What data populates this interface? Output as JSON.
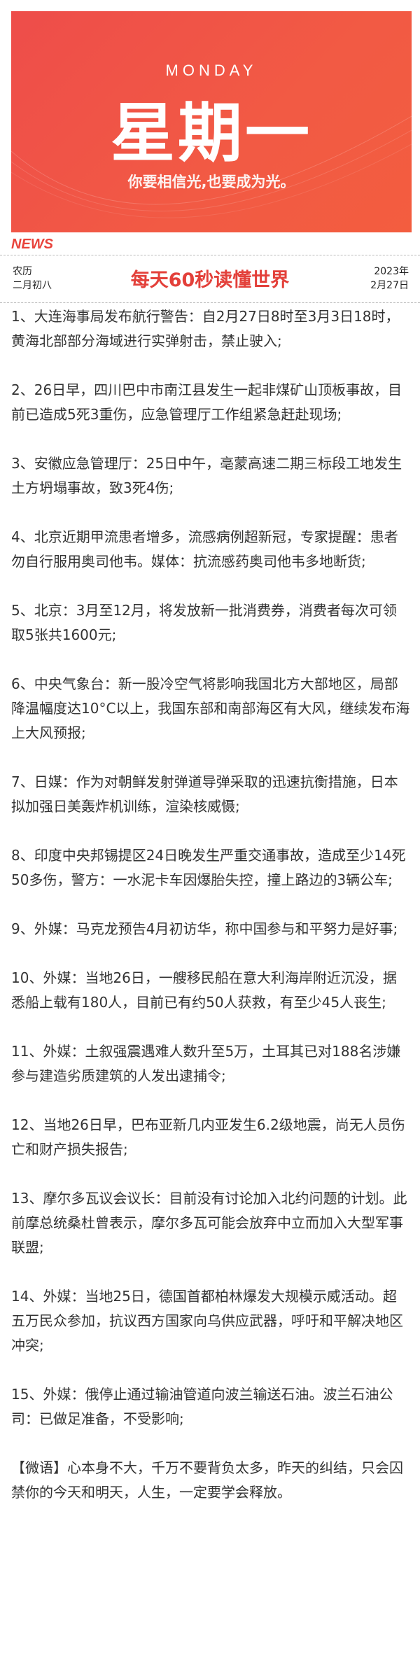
{
  "banner": {
    "weekday_en": "MONDAY",
    "weekday_cn": "星期一",
    "motto": "你要相信光,也要成为光。"
  },
  "news_label": "NEWS",
  "header": {
    "lunar_label": "农历",
    "lunar_date": "二月初八",
    "title": "每天60秒读懂世界",
    "year": "2023年",
    "date": "2月27日"
  },
  "colors": {
    "accent": "#e8433b",
    "banner": "#f05446",
    "text": "#333333"
  },
  "items": [
    "1、大连海事局发布航行警告：自2月27日8时至3月3日18时，黄海北部部分海域进行实弹射击，禁止驶入;",
    "2、26日早，四川巴中市南江县发生一起非煤矿山顶板事故，目前已造成5死3重伤，应急管理厅工作组紧急赶赴现场;",
    "3、安徽应急管理厅：25日中午，亳蒙高速二期三标段工地发生土方坍塌事故，致3死4伤;",
    "4、北京近期甲流患者增多，流感病例超新冠，专家提醒：患者勿自行服用奥司他韦。媒体：抗流感药奥司他韦多地断货;",
    "5、北京：3月至12月，将发放新一批消费券，消费者每次可领取5张共1600元;",
    "6、中央气象台：新一股冷空气将影响我国北方大部地区，局部降温幅度达10°C以上，我国东部和南部海区有大风，继续发布海上大风预报;",
    "7、日媒：作为对朝鲜发射弹道导弹采取的迅速抗衡措施，日本拟加强日美轰炸机训练，渲染核威慑;",
    "8、印度中央邦锡提区24日晚发生严重交通事故，造成至少14死50多伤，警方：一水泥卡车因爆胎失控，撞上路边的3辆公车;",
    "9、外媒：马克龙预告4月初访华，称中国参与和平努力是好事;",
    "10、外媒：当地26日，一艘移民船在意大利海岸附近沉没，据悉船上载有180人，目前已有约50人获救，有至少45人丧生;",
    "11、外媒：土叙强震遇难人数升至5万，土耳其已对188名涉嫌参与建造劣质建筑的人发出逮捕令;",
    "12、当地26日早，巴布亚新几内亚发生6.2级地震，尚无人员伤亡和财产损失报告;",
    "13、摩尔多瓦议会议长：目前没有讨论加入北约问题的计划。此前摩总统桑杜曾表示，摩尔多瓦可能会放弃中立而加入大型军事联盟;",
    "14、外媒：当地25日，德国首都柏林爆发大规模示威活动。超五万民众参加，抗议西方国家向乌供应武器，呼吁和平解决地区冲突;",
    "15、外媒：俄停止通过输油管道向波兰输送石油。波兰石油公司：已做足准备，不受影响;",
    "【微语】心本身不大，千万不要背负太多，昨天的纠结，只会囚禁你的今天和明天，人生，一定要学会释放。"
  ]
}
